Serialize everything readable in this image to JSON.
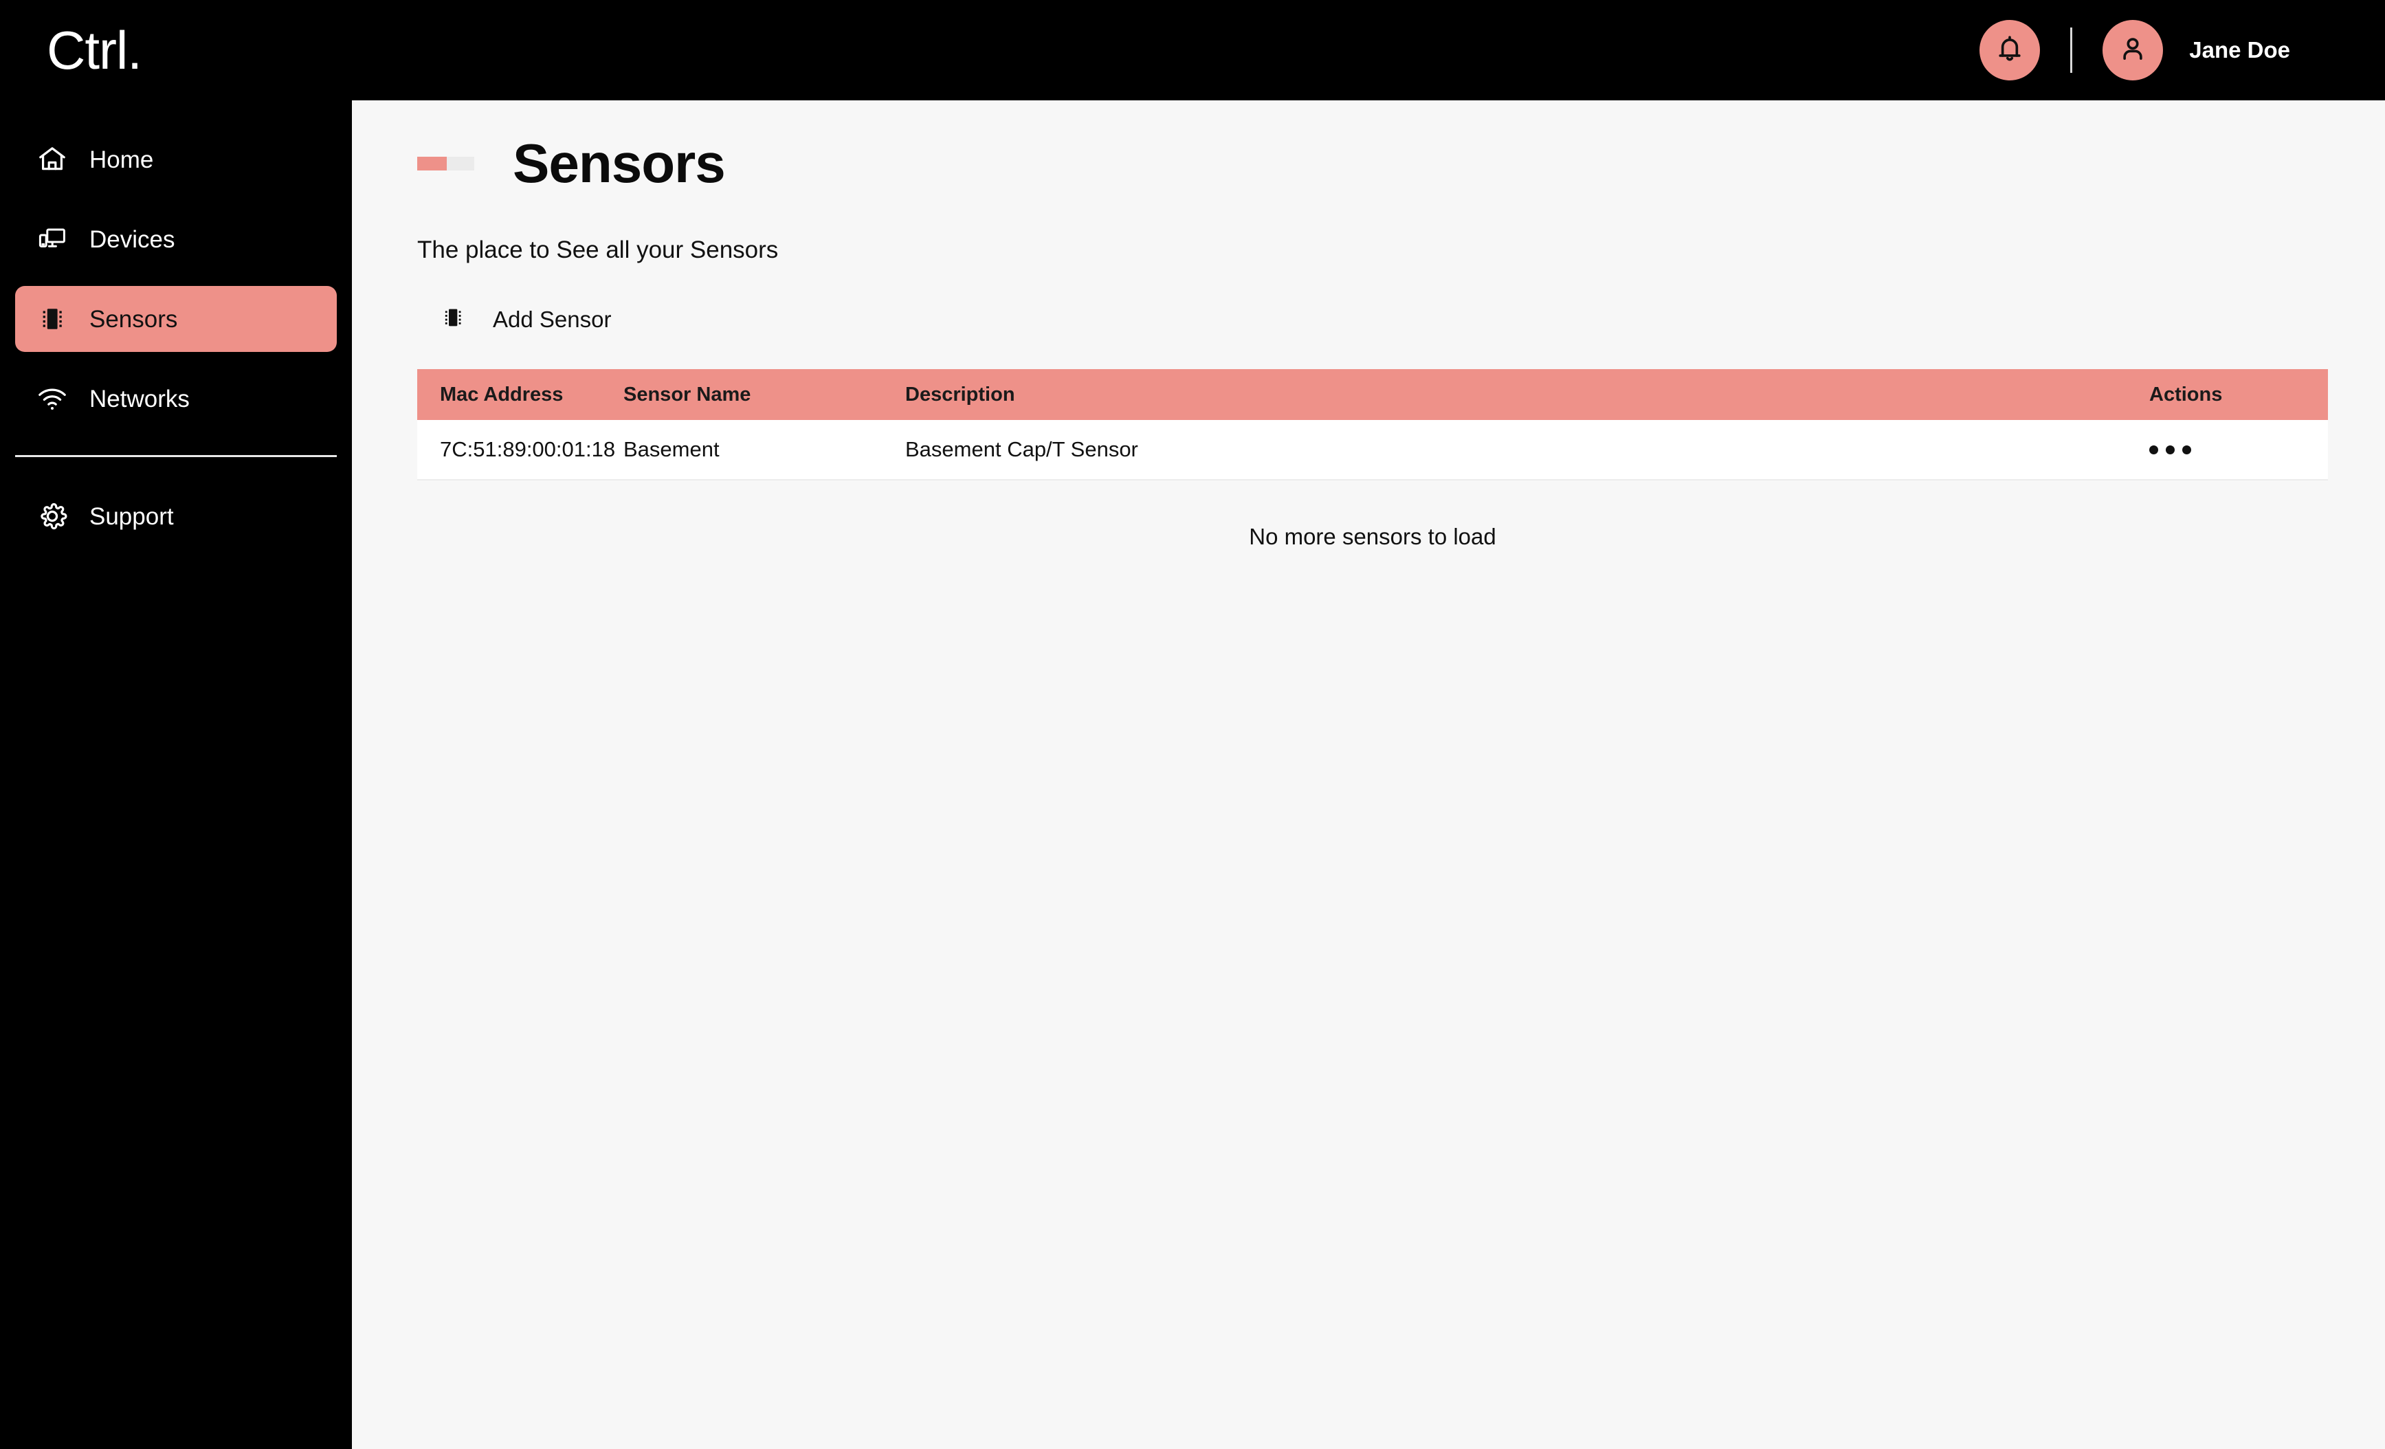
{
  "brand": {
    "logo_text": "Ctrl."
  },
  "topbar": {
    "notification_icon": "bell-icon",
    "avatar_icon": "user-avatar-icon",
    "user_name": "Jane Doe"
  },
  "sidebar": {
    "items": [
      {
        "label": "Home",
        "icon": "home-icon",
        "active": false
      },
      {
        "label": "Devices",
        "icon": "devices-icon",
        "active": false
      },
      {
        "label": "Sensors",
        "icon": "chip-icon",
        "active": true
      },
      {
        "label": "Networks",
        "icon": "wifi-icon",
        "active": false
      }
    ],
    "footer_items": [
      {
        "label": "Support",
        "icon": "gear-icon",
        "active": false
      }
    ]
  },
  "main": {
    "page_title": "Sensors",
    "subtitle": "The place to See all your Sensors",
    "add_sensor": {
      "label": "Add Sensor",
      "icon": "chip-icon"
    },
    "table": {
      "columns": [
        "Mac Address",
        "Sensor Name",
        "Description",
        "Actions"
      ],
      "rows": [
        {
          "mac": "7C:51:89:00:01:18",
          "name": "Basement",
          "description": "Basement Cap/T Sensor",
          "actions_icon": "ellipsis-icon"
        }
      ]
    },
    "empty_note": "No more sensors to load"
  },
  "colors": {
    "accent": "#EE9189",
    "accent_muted": "#EBEBEB",
    "sidebar_bg": "#000000",
    "page_bg": "#F7F7F7",
    "row_bg": "#FFFFFF",
    "text_dark": "#111111",
    "text_light": "#FFFFFF"
  }
}
